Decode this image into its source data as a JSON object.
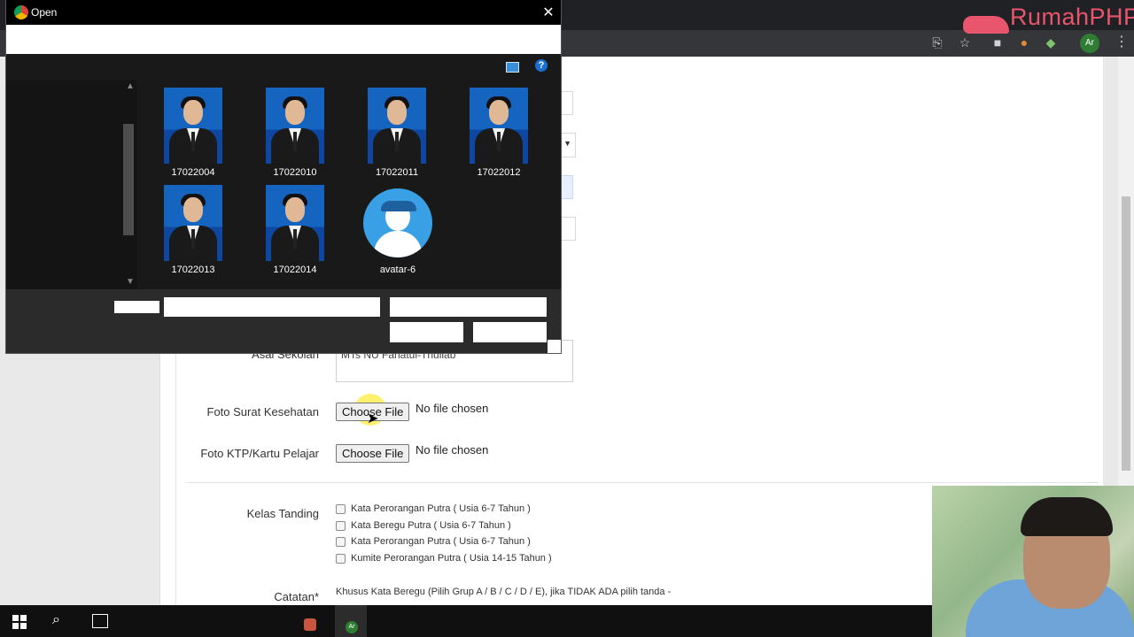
{
  "browser": {
    "profile_initials": "Ar",
    "logo_text": "RumahPHP",
    "toolbar_icons": [
      "translate-icon",
      "star-icon",
      "extension-cube-icon",
      "extension-tiger-icon",
      "extension-palette-icon"
    ]
  },
  "dialog": {
    "title": "Open",
    "close_glyph": "✕",
    "help_glyph": "?",
    "files": [
      {
        "name": "17022004",
        "kind": "photo"
      },
      {
        "name": "17022010",
        "kind": "photo"
      },
      {
        "name": "17022011",
        "kind": "photo"
      },
      {
        "name": "17022012",
        "kind": "photo"
      },
      {
        "name": "17022013",
        "kind": "photo"
      },
      {
        "name": "17022014",
        "kind": "photo"
      },
      {
        "name": "avatar-6",
        "kind": "avatar"
      }
    ]
  },
  "form": {
    "asal_sekolah_label": "Asal Sekolah",
    "asal_sekolah_value": "MTs NU Fahatul-Thullab",
    "foto_surat_label": "Foto Surat Kesehatan",
    "foto_ktp_label": "Foto KTP/Kartu Pelajar",
    "choose_file": "Choose File",
    "no_file": "No file chosen",
    "kelas_label": "Kelas Tanding",
    "kelas_options": [
      "Kata Perorangan Putra ( Usia 6-7 Tahun )",
      "Kata Beregu Putra ( Usia 6-7 Tahun )",
      "Kata Perorangan Putra ( Usia 6-7 Tahun )",
      "Kumite Perorangan Putra ( Usia 14-15 Tahun )"
    ],
    "catatan_label": "Catatan*",
    "catatan_text": "Khusus Kata Beregu (Pilih Grup A / B / C / D / E), jika TIDAK ADA pilih tanda -"
  },
  "taskbar": {
    "app_initials": "Ar"
  }
}
